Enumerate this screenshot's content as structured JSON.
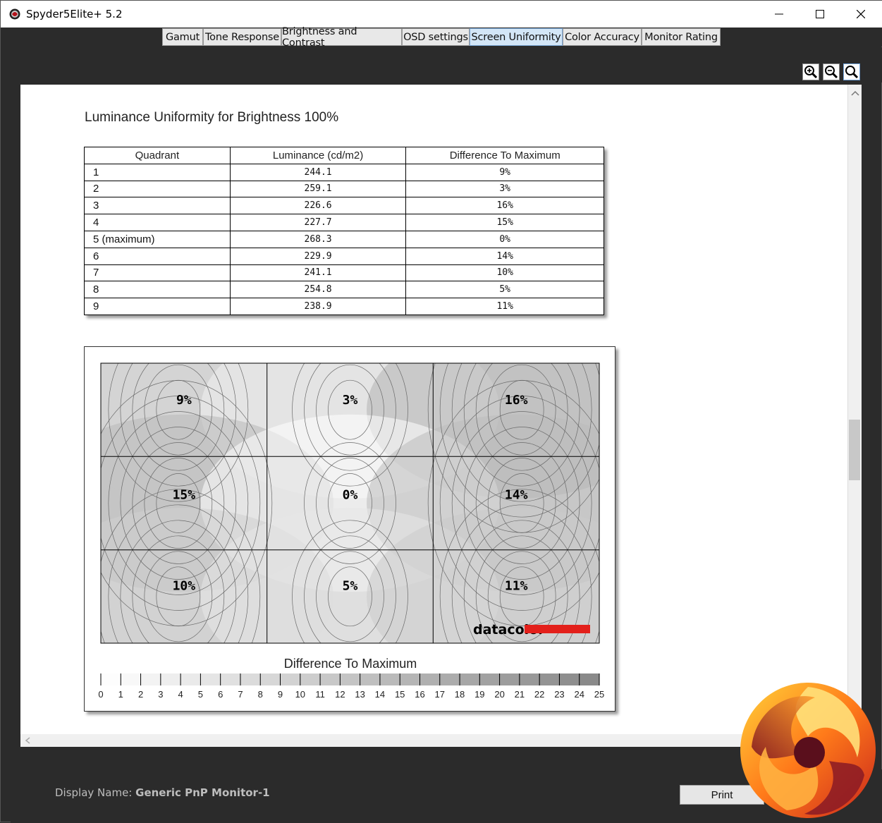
{
  "window": {
    "title": "Spyder5Elite+ 5.2",
    "icons": {
      "app": "spyder-app-icon",
      "minimize": "minimize-icon",
      "maximize": "maximize-icon",
      "close": "close-icon"
    }
  },
  "tabs": [
    {
      "label": "Gamut",
      "active": false
    },
    {
      "label": "Tone Response",
      "active": false
    },
    {
      "label": "Brightness and Contrast",
      "active": false
    },
    {
      "label": "OSD settings",
      "active": false
    },
    {
      "label": "Screen Uniformity",
      "active": true
    },
    {
      "label": "Color Accuracy",
      "active": false
    },
    {
      "label": "Monitor Rating",
      "active": false
    }
  ],
  "zoom": {
    "zoom_in": "zoom-in-icon",
    "zoom_out": "zoom-out-icon",
    "zoom_fit": "zoom-fit-icon"
  },
  "report": {
    "title": "Luminance Uniformity for Brightness 100%",
    "table": {
      "headers": [
        "Quadrant",
        "Luminance (cd/m2)",
        "Difference To Maximum"
      ],
      "rows": [
        [
          "1",
          "244.1",
          "9%"
        ],
        [
          "2",
          "259.1",
          "3%"
        ],
        [
          "3",
          "226.6",
          "16%"
        ],
        [
          "4",
          "227.7",
          "15%"
        ],
        [
          "5 (maximum)",
          "268.3",
          "0%"
        ],
        [
          "6",
          "229.9",
          "14%"
        ],
        [
          "7",
          "241.1",
          "10%"
        ],
        [
          "8",
          "254.8",
          "5%"
        ],
        [
          "9",
          "238.9",
          "11%"
        ]
      ]
    }
  },
  "chart_data": {
    "type": "heatmap",
    "grid": [
      [
        "9%",
        "3%",
        "16%"
      ],
      [
        "15%",
        "0%",
        "14%"
      ],
      [
        "10%",
        "5%",
        "11%"
      ]
    ],
    "values": [
      [
        9,
        3,
        16
      ],
      [
        15,
        0,
        14
      ],
      [
        10,
        5,
        11
      ]
    ],
    "legend_title": "Difference To Maximum",
    "scale_min": 0,
    "scale_max": 25,
    "scale_ticks": [
      "0",
      "1",
      "2",
      "3",
      "4",
      "5",
      "6",
      "7",
      "8",
      "9",
      "10",
      "11",
      "12",
      "13",
      "14",
      "15",
      "16",
      "17",
      "18",
      "19",
      "20",
      "21",
      "22",
      "23",
      "24",
      "25"
    ],
    "watermark": "datacolor",
    "colors": {
      "low": "#ffffff",
      "high": "#888888",
      "brand_red": "#e3201b"
    }
  },
  "footer": {
    "display_label": "Display Name: ",
    "display_value": "Generic PnP Monitor-1",
    "print_label": "Print"
  },
  "logo": "bit-tech-swirl-logo"
}
